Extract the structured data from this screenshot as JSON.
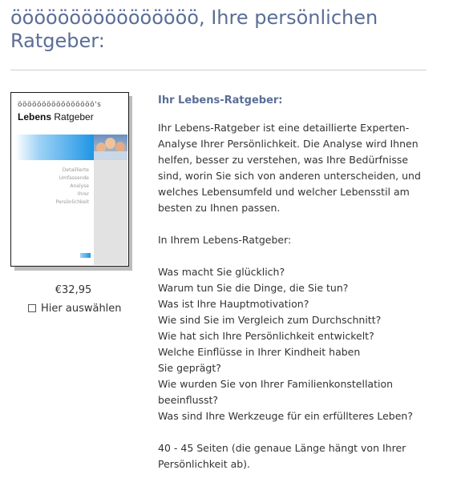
{
  "header": {
    "title": "öööööööööööööööö, Ihre persönlichen Ratgeber:"
  },
  "product": {
    "cover": {
      "brand": "öööööööööööööööö's",
      "title_bold": "Lebens",
      "title_rest": " Ratgeber",
      "subtitle_lines": [
        "Detaillierte",
        "Umfassende",
        "Analyse",
        "Ihrer",
        "Persönlichkeit"
      ]
    },
    "price": "€32,95",
    "select_label": "Hier auswählen"
  },
  "content": {
    "heading": "Ihr Lebens-Ratgeber:",
    "intro": "Ihr Lebens-Ratgeber ist eine detaillierte Experten-Analyse Ihrer Persönlichkeit. Die Analyse wird Ihnen helfen, besser zu verstehen, was Ihre Bedürfnisse sind, worin Sie sich von anderen unterscheiden, und welches Lebensumfeld und welcher Lebensstil am besten zu Ihnen passen.",
    "list_intro": "In Ihrem Lebens-Ratgeber:",
    "questions": [
      "Was macht Sie glücklich?",
      "Warum tun Sie die Dinge, die Sie tun?",
      "Was ist Ihre Hauptmotivation?",
      "Wie sind Sie im Vergleich zum Durchschnitt?",
      "Wie hat sich Ihre Persönlichkeit entwickelt?",
      "Welche Einflüsse in Ihrer Kindheit haben Sie geprägt?",
      "Wie wurden Sie von Ihrer Familienkonstellation beeinflusst?",
      "Was sind Ihre Werkzeuge für ein erfüllteres Leben?"
    ],
    "pages_note": "40 - 45 Seiten (die genaue Länge hängt von Ihrer Persönlichkeit ab)."
  },
  "colors": {
    "heading": "#5a6e96",
    "text": "#333333",
    "divider": "#cfcfcf",
    "cover_accent": "#1e95e6"
  }
}
